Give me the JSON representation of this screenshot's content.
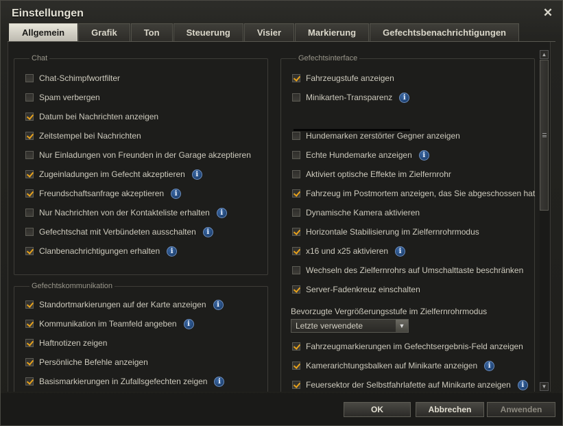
{
  "window": {
    "title": "Einstellungen"
  },
  "tabs": [
    "Allgemein",
    "Grafik",
    "Ton",
    "Steuerung",
    "Visier",
    "Markierung",
    "Gefechtsbenachrichtigungen"
  ],
  "chat": {
    "legend": "Chat",
    "items": [
      {
        "label": "Chat-Schimpfwortfilter",
        "checked": false,
        "info": false
      },
      {
        "label": "Spam verbergen",
        "checked": false,
        "info": false
      },
      {
        "label": "Datum bei Nachrichten anzeigen",
        "checked": true,
        "info": false
      },
      {
        "label": "Zeitstempel bei Nachrichten",
        "checked": true,
        "info": false
      },
      {
        "label": "Nur Einladungen von Freunden in der Garage akzeptieren",
        "checked": false,
        "info": false
      },
      {
        "label": "Zugeinladungen im Gefecht akzeptieren",
        "checked": true,
        "info": true
      },
      {
        "label": "Freundschaftsanfrage akzeptieren",
        "checked": true,
        "info": true
      },
      {
        "label": "Nur Nachrichten von der Kontakteliste erhalten",
        "checked": false,
        "info": true
      },
      {
        "label": "Gefechtschat mit Verbündeten ausschalten",
        "checked": false,
        "info": true
      },
      {
        "label": "Clanbenachrichtigungen erhalten",
        "checked": true,
        "info": true
      }
    ]
  },
  "comm": {
    "legend": "Gefechtskommunikation",
    "items": [
      {
        "label": "Standortmarkierungen auf der Karte anzeigen",
        "checked": true,
        "info": true
      },
      {
        "label": "Kommunikation im Teamfeld angeben",
        "checked": true,
        "info": true
      },
      {
        "label": "Haftnotizen zeigen",
        "checked": true,
        "info": false
      },
      {
        "label": "Persönliche Befehle anzeigen",
        "checked": true,
        "info": false
      },
      {
        "label": "Basismarkierungen in Zufallsgefechten zeigen",
        "checked": true,
        "info": true
      }
    ]
  },
  "interface": {
    "legend": "Gefechtsinterface",
    "top_items": [
      {
        "label": "Fahrzeugstufe anzeigen",
        "checked": true,
        "info": false
      },
      {
        "label": "Minikarten-Transparenz",
        "checked": false,
        "info": true
      }
    ],
    "items": [
      {
        "label": "Hundemarken zerstörter Gegner anzeigen",
        "checked": false,
        "info": false
      },
      {
        "label": "Echte Hundemarke anzeigen",
        "checked": false,
        "info": true
      },
      {
        "label": "Aktiviert optische Effekte im Zielfernrohr",
        "checked": false,
        "info": false
      },
      {
        "label": "Fahrzeug im Postmortem anzeigen, das Sie abgeschossen hat",
        "checked": true,
        "info": false
      },
      {
        "label": "Dynamische Kamera aktivieren",
        "checked": false,
        "info": false
      },
      {
        "label": "Horizontale Stabilisierung im Zielfernrohrmodus",
        "checked": true,
        "info": false
      },
      {
        "label": "x16 und x25 aktivieren",
        "checked": true,
        "info": true
      },
      {
        "label": "Wechseln des Zielfernrohrs auf Umschalttaste beschränken",
        "checked": false,
        "info": false
      },
      {
        "label": "Server-Fadenkreuz einschalten",
        "checked": true,
        "info": false
      }
    ],
    "zoom_label": "Bevorzugte Vergrößerungsstufe im Zielfernrohrmodus",
    "zoom_value": "Letzte verwendete",
    "bottom_items": [
      {
        "label": "Fahrzeugmarkierungen im Gefechtsergebnis-Feld anzeigen",
        "checked": true,
        "info": false
      },
      {
        "label": "Kamerarichtungsbalken auf Minikarte anzeigen",
        "checked": true,
        "info": true
      },
      {
        "label": "Feuersektor der Selbstfahrlafette auf Minikarte anzeigen",
        "checked": true,
        "info": true
      }
    ]
  },
  "footer": {
    "ok": "OK",
    "cancel": "Abbrechen",
    "apply": "Anwenden"
  },
  "icons": {
    "close": "close-icon",
    "info": "info-icon",
    "check": "checkmark-icon"
  },
  "colors": {
    "accent_check": "#e8a21b",
    "info_blue": "#2a5590"
  }
}
